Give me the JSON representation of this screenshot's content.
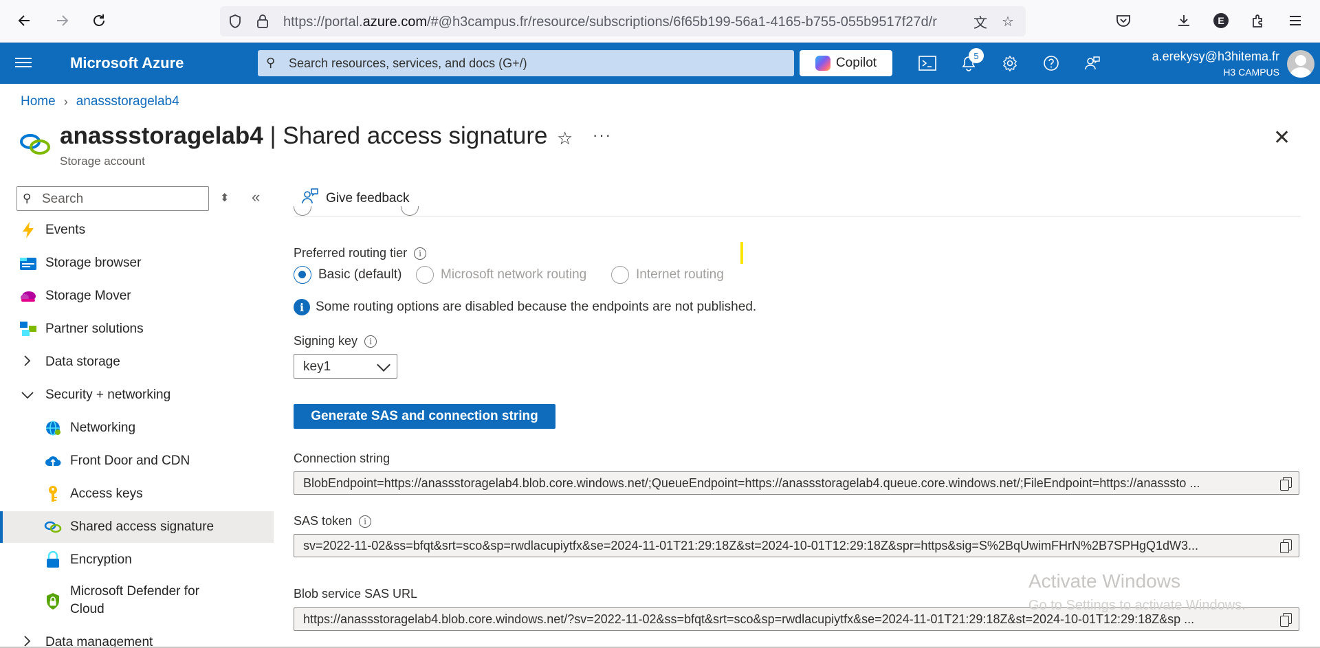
{
  "browser": {
    "url_prefix": "https://portal.",
    "url_domain": "azure.com",
    "url_rest": "/#@h3campus.fr/resource/subscriptions/6f65b199-56a1-4165-b755-055b9517f27d/r"
  },
  "header": {
    "brand": "Microsoft Azure",
    "search_placeholder": "Search resources, services, and docs (G+/)",
    "copilot_label": "Copilot",
    "notification_count": "5",
    "user_email": "a.erekysy@h3hitema.fr",
    "user_org": "H3 CAMPUS",
    "accent_color": "#0f6cbd"
  },
  "breadcrumb": {
    "home": "Home",
    "resource": "anassstoragelab4"
  },
  "page": {
    "resource_name": "anassstoragelab4",
    "section_title": " | Shared access signature",
    "subtitle": "Storage account",
    "star_glyph": "☆",
    "more_glyph": "···",
    "close_glyph": "✕"
  },
  "sidebar": {
    "search_placeholder": "Search",
    "items": [
      {
        "label": "Events",
        "icon": "lightning-icon"
      },
      {
        "label": "Storage browser",
        "icon": "storage-browser-icon"
      },
      {
        "label": "Storage Mover",
        "icon": "cloud-mover-icon"
      },
      {
        "label": "Partner solutions",
        "icon": "partner-icon"
      },
      {
        "label": "Data storage",
        "icon": "chevron-right-icon"
      },
      {
        "label": "Security + networking",
        "icon": "chevron-down-icon"
      },
      {
        "label": "Networking",
        "icon": "globe-icon"
      },
      {
        "label": "Front Door and CDN",
        "icon": "cloud-cdn-icon"
      },
      {
        "label": "Access keys",
        "icon": "key-icon"
      },
      {
        "label": "Shared access signature",
        "icon": "link-icon"
      },
      {
        "label": "Encryption",
        "icon": "lock-icon"
      },
      {
        "label": "Microsoft Defender for",
        "label2": "Cloud",
        "icon": "shield-icon"
      },
      {
        "label": "Data management",
        "icon": "chevron-right-icon"
      }
    ]
  },
  "command_bar": {
    "feedback_label": "Give feedback"
  },
  "form": {
    "routing_label": "Preferred routing tier",
    "routing_options": [
      {
        "label": "Basic (default)",
        "checked": true,
        "disabled": false
      },
      {
        "label": "Microsoft network routing",
        "checked": false,
        "disabled": true
      },
      {
        "label": "Internet routing",
        "checked": false,
        "disabled": true
      }
    ],
    "routing_info": "Some routing options are disabled because the endpoints are not published.",
    "signing_key_label": "Signing key",
    "signing_key_value": "key1",
    "generate_button": "Generate SAS and connection string",
    "connection_string_label": "Connection string",
    "connection_string_value": "BlobEndpoint=https://anassstoragelab4.blob.core.windows.net/;QueueEndpoint=https://anassstoragelab4.queue.core.windows.net/;FileEndpoint=https://anasssto ...",
    "sas_token_label": "SAS token",
    "sas_token_value": "sv=2022-11-02&ss=bfqt&srt=sco&sp=rwdlacupiytfx&se=2024-11-01T21:29:18Z&st=2024-10-01T12:29:18Z&spr=https&sig=S%2BqUwimFHrN%2B7SPHgQ1dW3...",
    "blob_sas_url_label": "Blob service SAS URL",
    "blob_sas_url_value": "https://anassstoragelab4.blob.core.windows.net/?sv=2022-11-02&ss=bfqt&srt=sco&sp=rwdlacupiytfx&se=2024-11-01T21:29:18Z&st=2024-10-01T12:29:18Z&sp ..."
  },
  "watermark": {
    "line1": "Activate Windows",
    "line2": "Go to Settings to activate Windows."
  }
}
